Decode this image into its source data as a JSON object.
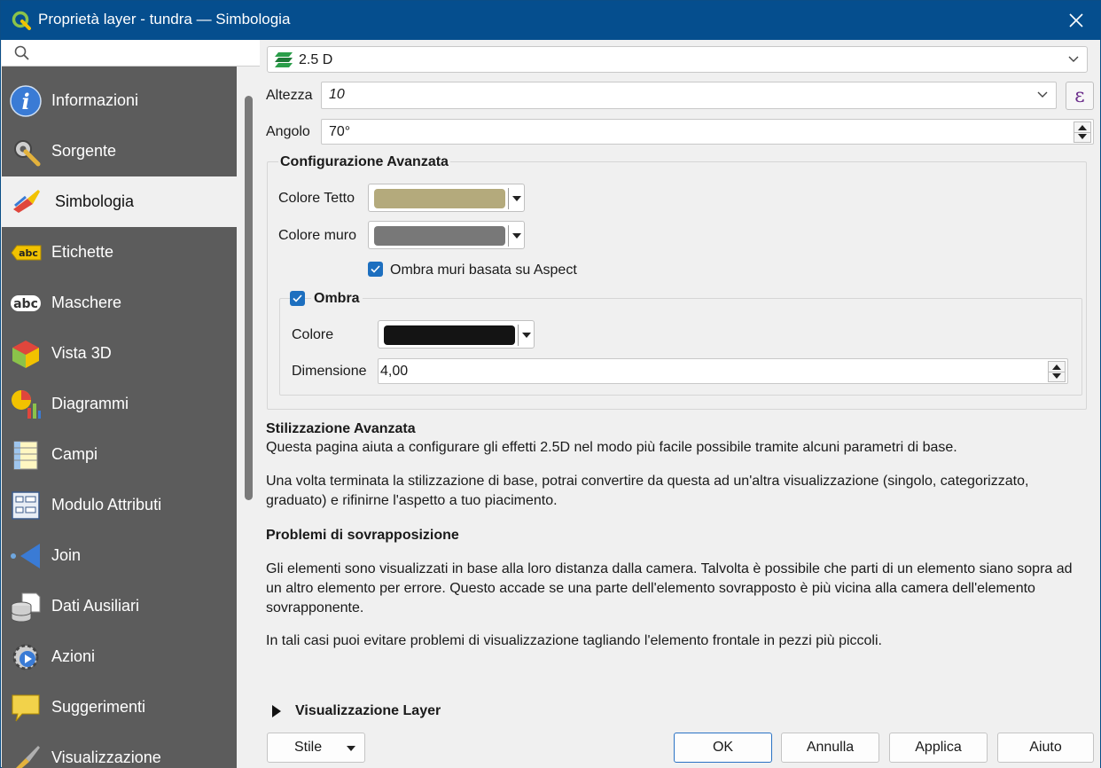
{
  "window": {
    "title": "Proprietà layer - tundra — Simbologia"
  },
  "sidebar": {
    "search_placeholder": "",
    "items": [
      {
        "label": "Informazioni",
        "icon": "info-icon"
      },
      {
        "label": "Sorgente",
        "icon": "source-wrench-icon"
      },
      {
        "label": "Simbologia",
        "icon": "symbology-brush-icon",
        "active": true
      },
      {
        "label": "Etichette",
        "icon": "labels-abc-icon"
      },
      {
        "label": "Maschere",
        "icon": "masks-abc-icon"
      },
      {
        "label": "Vista 3D",
        "icon": "3d-cube-icon"
      },
      {
        "label": "Diagrammi",
        "icon": "diagrams-icon"
      },
      {
        "label": "Campi",
        "icon": "fields-icon"
      },
      {
        "label": "Modulo Attributi",
        "icon": "attributes-form-icon"
      },
      {
        "label": "Join",
        "icon": "join-icon"
      },
      {
        "label": "Dati Ausiliari",
        "icon": "auxiliary-storage-icon"
      },
      {
        "label": "Azioni",
        "icon": "actions-icon"
      },
      {
        "label": "Suggerimenti",
        "icon": "maptips-icon"
      },
      {
        "label": "Visualizzazione",
        "icon": "display-icon"
      }
    ]
  },
  "renderer": {
    "value": "2.5 D"
  },
  "height": {
    "label": "Altezza",
    "value": "10"
  },
  "angle": {
    "label": "Angolo",
    "value": "70°"
  },
  "advanced_config": {
    "title": "Configurazione Avanzata",
    "roof_color_label": "Colore Tetto",
    "roof_color": "#b4aa7c",
    "wall_color_label": "Colore muro",
    "wall_color": "#787878",
    "shade_walls_label": "Ombra muri basata su Aspect",
    "shade_walls_checked": true,
    "shadow": {
      "title": "Ombra",
      "checked": true,
      "color_label": "Colore",
      "color": "#141414",
      "size_label": "Dimensione",
      "size_value": "4,00"
    }
  },
  "help": {
    "heading": "Stilizzazione Avanzata",
    "p1": "Questa pagina aiuta a configurare gli effetti 2.5D nel modo più facile possibile tramite alcuni parametri di base.",
    "p2a": "Una volta terminata la stilizzazione di base, potrai convertire da questa ad un'altra visualizzazione (singolo, categorizzato,",
    "p2b": "graduato) e rifinirne l'aspetto a tuo piacimento.",
    "heading2": "Problemi di sovrapposizione",
    "p3a": "Gli elementi sono visualizzati in base alla loro distanza dalla camera. Talvolta è possibile che parti di un elemento siano sopra ad",
    "p3b": "un altro elemento per errore. Questo accade se una parte dell'elemento sovrapposto è più vicina alla camera dell'elemento",
    "p3c": "sovrapponente.",
    "p4": "In tali casi puoi evitare problemi di visualizzazione tagliando l'elemento frontale in pezzi più piccoli."
  },
  "layer_rendering": {
    "label": "Visualizzazione Layer"
  },
  "buttons": {
    "style": "Stile",
    "ok": "OK",
    "cancel": "Annulla",
    "apply": "Applica",
    "help": "Aiuto"
  }
}
